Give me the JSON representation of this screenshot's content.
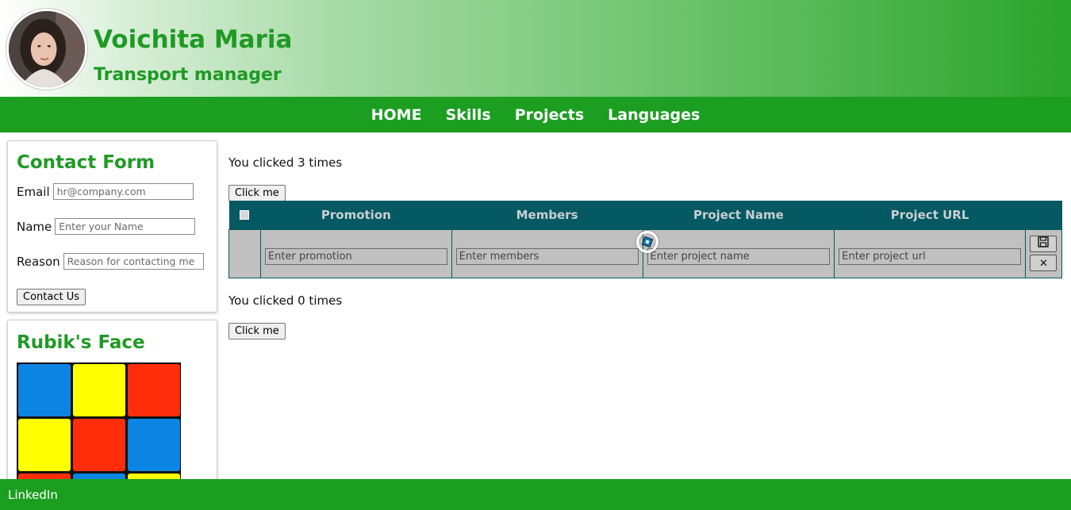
{
  "header": {
    "name": "Voichita Maria",
    "role": "Transport manager",
    "avatar_alt": "profile-photo"
  },
  "nav": {
    "items": [
      {
        "label": "HOME"
      },
      {
        "label": "Skills"
      },
      {
        "label": "Projects"
      },
      {
        "label": "Languages"
      }
    ]
  },
  "contact_form": {
    "title": "Contact Form",
    "email_label": "Email",
    "email_placeholder": "hr@company.com",
    "name_label": "Name",
    "name_placeholder": "Enter your Name",
    "reason_label": "Reason",
    "reason_placeholder": "Reason for contacting me",
    "submit_label": "Contact Us"
  },
  "rubik": {
    "title": "Rubik's Face",
    "tiles": [
      "#0b84e2",
      "#ffff00",
      "#ff2d0a",
      "#ffff00",
      "#ff2d0a",
      "#0b84e2",
      "#ff2d0a",
      "#0b84e2",
      "#ffff00"
    ]
  },
  "counter1": {
    "text": "You clicked 3 times",
    "button": "Click me"
  },
  "counter2": {
    "text": "You clicked 0 times",
    "button": "Click me"
  },
  "table": {
    "headers": [
      "Promotion",
      "Members",
      "Project Name",
      "Project URL"
    ],
    "placeholders": [
      "Enter promotion",
      "Enter members",
      "Enter project name",
      "Enter project url"
    ],
    "save_icon": "save-icon",
    "cancel_icon": "close-icon",
    "cancel_glyph": "✕"
  },
  "footer": {
    "link": "LinkedIn"
  },
  "colors": {
    "brand_green": "#1c9e21",
    "title_green": "#1f9a24",
    "table_header": "#045962",
    "table_row": "#c0c0c0"
  }
}
